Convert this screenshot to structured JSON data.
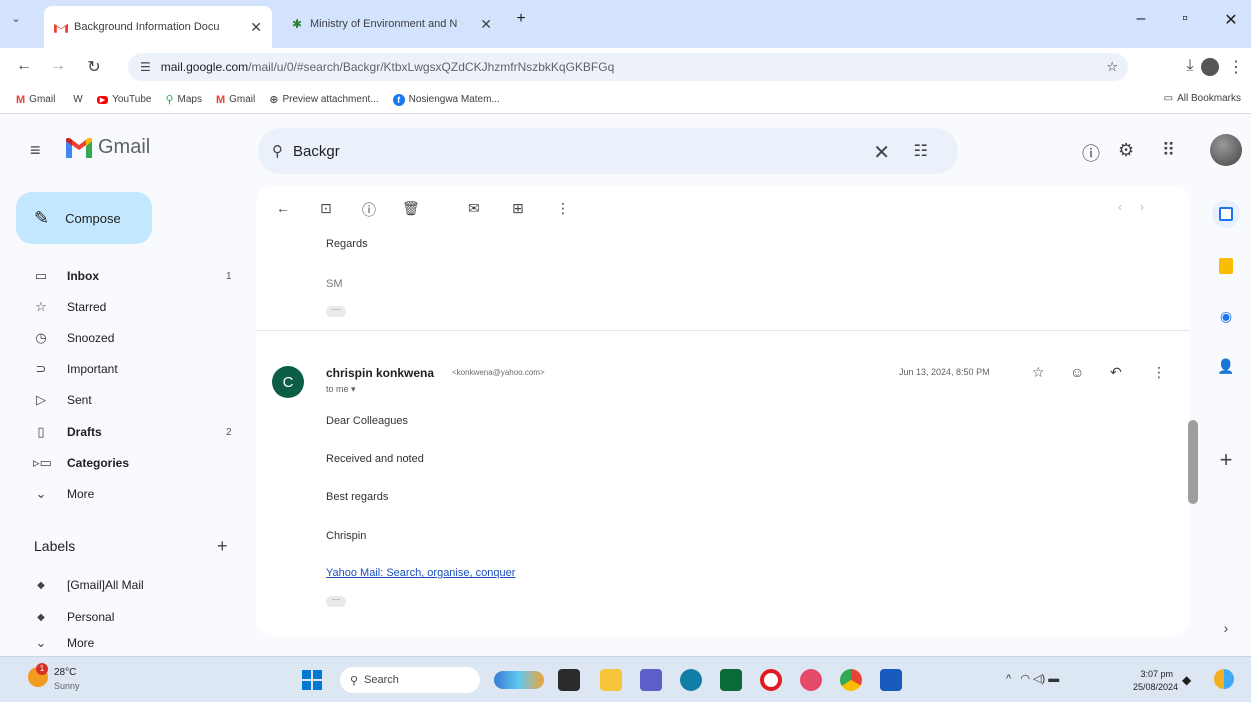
{
  "browser": {
    "tabs": [
      {
        "title": "Background Information Docu",
        "favicon": "gmail-icon",
        "active": true
      },
      {
        "title": "Ministry of Environment and N",
        "favicon": "ministry-icon",
        "active": false
      }
    ],
    "url_host": "mail.google.com",
    "url_path": "/mail/u/0/#search/Backgr/KtbxLwgsxQZdCKJhzmfrNszbkKqGKBFGq",
    "bookmarks": [
      {
        "label": "Gmail",
        "icon": "gmail-icon"
      },
      {
        "label": "W",
        "icon": "w-icon"
      },
      {
        "label": "YouTube",
        "icon": "youtube-icon"
      },
      {
        "label": "Maps",
        "icon": "maps-icon"
      },
      {
        "label": "Gmail",
        "icon": "gmail-icon"
      },
      {
        "label": "Preview attachment...",
        "icon": "preview-icon"
      },
      {
        "label": "Nosiengwa Matem...",
        "icon": "facebook-icon"
      }
    ],
    "all_bookmarks": "All Bookmarks"
  },
  "gmail": {
    "logo_text": "Gmail",
    "search_query": "Backgr",
    "compose_label": "Compose",
    "nav": [
      {
        "label": "Inbox",
        "icon": "inbox-icon",
        "count": "1",
        "bold": true
      },
      {
        "label": "Starred",
        "icon": "star-icon",
        "count": "",
        "bold": false
      },
      {
        "label": "Snoozed",
        "icon": "clock-icon",
        "count": "",
        "bold": false
      },
      {
        "label": "Important",
        "icon": "important-icon",
        "count": "",
        "bold": false
      },
      {
        "label": "Sent",
        "icon": "send-icon",
        "count": "",
        "bold": false
      },
      {
        "label": "Drafts",
        "icon": "draft-icon",
        "count": "2",
        "bold": true
      },
      {
        "label": "Categories",
        "icon": "categories-icon",
        "count": "",
        "bold": true
      },
      {
        "label": "More",
        "icon": "chevron-down-icon",
        "count": "",
        "bold": false
      }
    ],
    "labels_heading": "Labels",
    "labels": [
      {
        "label": "[Gmail]All Mail",
        "icon": "label-icon"
      },
      {
        "label": "Personal",
        "icon": "label-icon"
      },
      {
        "label": "More",
        "icon": "chevron-down-icon"
      }
    ]
  },
  "email": {
    "prev_signoff": "Regards",
    "prev_initials": "SM",
    "sender_initial": "C",
    "sender_name": "chrispin konkwena",
    "sender_email": "<konkwena@yahoo.com>",
    "to_line": "to me ▾",
    "date": "Jun 13, 2024, 8:50 PM",
    "body": [
      "Dear Colleagues",
      "Received and noted",
      "Best regards",
      "Chrispin"
    ],
    "link_text": "Yahoo Mail: Search, organise, conquer"
  },
  "taskbar": {
    "temperature": "28°C",
    "condition": "Sunny",
    "weather_badge": "1",
    "search_label": "Search",
    "time": "3:07 pm",
    "date": "25/08/2024"
  },
  "colors": {
    "compose_bg": "#c2e7ff",
    "avatar_bg": "#0b5e45",
    "tabbar_bg": "#d3e3fd",
    "link": "#1a4fbd"
  }
}
